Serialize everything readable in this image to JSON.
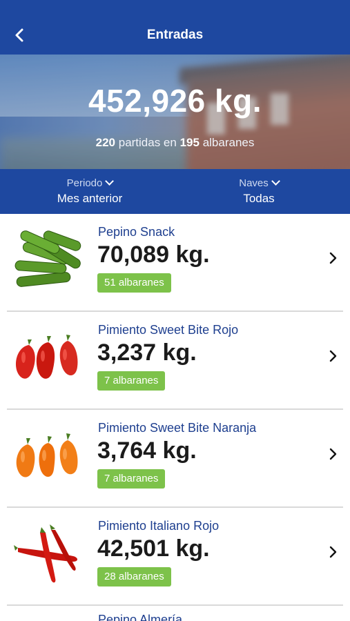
{
  "header": {
    "title": "Entradas",
    "back_icon": "chevron-left-icon"
  },
  "summary": {
    "total": "452,926 kg.",
    "partidas_count": "220",
    "partidas_text": "partidas en",
    "albaranes_count": "195",
    "albaranes_text": "albaranes"
  },
  "filters": {
    "periodo": {
      "label": "Periodo",
      "value": "Mes anterior"
    },
    "naves": {
      "label": "Naves",
      "value": "Todas"
    }
  },
  "products": [
    {
      "name": "Pepino Snack",
      "kg": "70,089 kg.",
      "albaranes": "51 albaranes",
      "image": "cucumber"
    },
    {
      "name": "Pimiento Sweet Bite Rojo",
      "kg": "3,237 kg.",
      "albaranes": "7 albaranes",
      "image": "red-pepper"
    },
    {
      "name": "Pimiento Sweet Bite Naranja",
      "kg": "3,764 kg.",
      "albaranes": "7 albaranes",
      "image": "orange-pepper"
    },
    {
      "name": "Pimiento Italiano Rojo",
      "kg": "42,501 kg.",
      "albaranes": "28 albaranes",
      "image": "italian-pepper"
    },
    {
      "name": "Pepino Almería",
      "kg": "",
      "albaranes": "",
      "image": ""
    }
  ],
  "colors": {
    "primary": "#1e48a0",
    "badge": "#7dc24a",
    "product_name": "#1e3f8f"
  }
}
